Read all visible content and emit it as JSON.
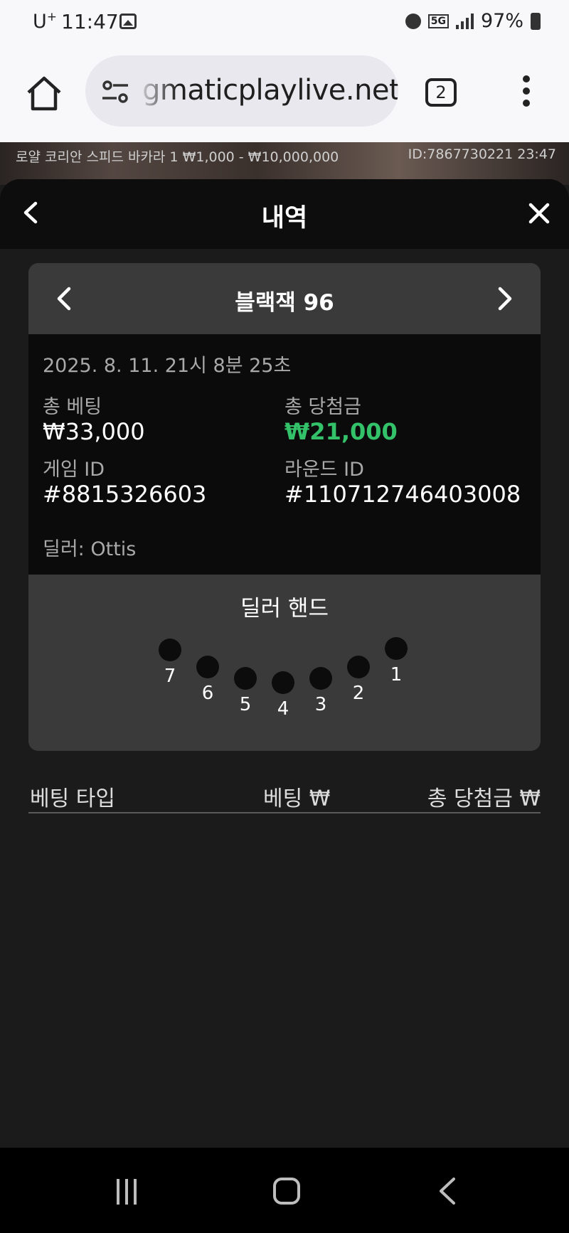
{
  "status_bar": {
    "carrier": "U",
    "carrier_sup": "+",
    "time": "11:47",
    "network": "5G",
    "battery": "97%"
  },
  "browser": {
    "url": "gmaticplaylive.net",
    "tab_count": "2"
  },
  "stream": {
    "title": "로얄 코리안 스피드 바카라 1  ₩1,000 - ₩10,000,000",
    "session_info": "ID:7867730221  23:47"
  },
  "panel": {
    "title": "내역"
  },
  "game_card": {
    "title": "블랙잭 96",
    "date": "2025. 8. 11. 21시 8분 25초",
    "total_bet_label": "총 베팅",
    "total_bet_value": "₩33,000",
    "total_win_label": "총 당첨금",
    "total_win_value": "₩21,000",
    "game_id_label": "게임 ID",
    "game_id_value": "#8815326603",
    "round_id_label": "라운드 ID",
    "round_id_value": "#110712746403008",
    "dealer": "딜러: Ottis",
    "hand_title": "딜러 핸드",
    "seats": [
      "7",
      "6",
      "5",
      "4",
      "3",
      "2",
      "1"
    ]
  },
  "bets_table": {
    "col_type": "베팅 타입",
    "col_bet": "베팅 ₩",
    "col_win": "총 당첨금 ₩"
  },
  "colors": {
    "win_green": "#33c26a",
    "panel_bg": "#1b1b1b",
    "card_bg": "#3a3a3a",
    "info_bg": "#0b0b0b"
  }
}
